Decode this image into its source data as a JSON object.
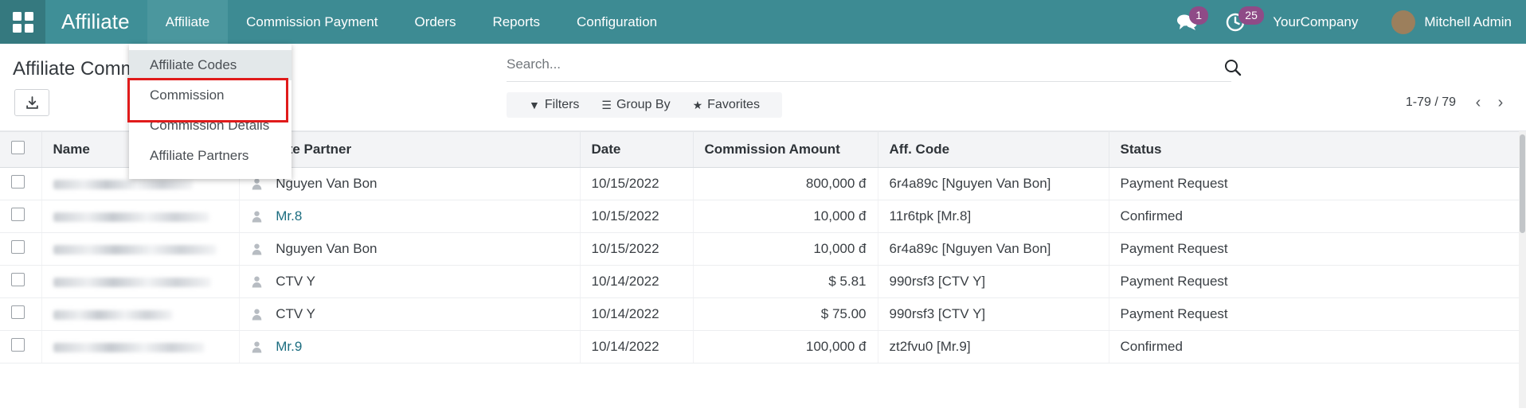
{
  "navbar": {
    "apps_icon": "apps-grid-icon",
    "brand": "Affiliate",
    "menu": [
      {
        "label": "Affiliate",
        "active": true
      },
      {
        "label": "Commission Payment",
        "active": false
      },
      {
        "label": "Orders",
        "active": false
      },
      {
        "label": "Reports",
        "active": false
      },
      {
        "label": "Configuration",
        "active": false
      }
    ],
    "messages_icon": "chat-bubbles-icon",
    "messages_badge": "1",
    "activities_icon": "clock-icon",
    "activities_badge": "25",
    "company": "YourCompany",
    "avatar_icon": "user-avatar",
    "user": "Mitchell Admin"
  },
  "dropdown": {
    "items": [
      {
        "label": "Affiliate Codes",
        "hovered": true
      },
      {
        "label": "Commission",
        "hovered": false
      },
      {
        "label": "Commission Details",
        "hovered": false
      },
      {
        "label": "Affiliate Partners",
        "hovered": false
      }
    ],
    "highlight_color": "#e01b1b"
  },
  "control_panel": {
    "breadcrumb": "Affiliate Comm",
    "export_button_icon": "download-icon",
    "search": {
      "placeholder": "Search...",
      "value": "",
      "search_icon": "search-icon"
    },
    "filter_bar": [
      {
        "label": "Filters",
        "icon": "funnel-icon"
      },
      {
        "label": "Group By",
        "icon": "hamburger-icon"
      },
      {
        "label": "Favorites",
        "icon": "star-icon"
      }
    ],
    "pager": {
      "count": "1-79 / 79",
      "prev_icon": "chevron-left-icon",
      "next_icon": "chevron-right-icon"
    }
  },
  "table": {
    "columns": [
      "",
      "Name",
      "Affiliate Partner",
      "Date",
      "Commission Amount",
      "Aff. Code",
      "Status"
    ],
    "rows": [
      {
        "name": "",
        "name_blurred": true,
        "partner": "Nguyen Van Bon",
        "date": "10/15/2022",
        "amount": "800,000 đ",
        "code": "6r4a89c [Nguyen Van Bon]",
        "status": "Payment Request",
        "link": false
      },
      {
        "name": "",
        "name_blurred": true,
        "partner": "Mr.8",
        "date": "10/15/2022",
        "amount": "10,000 đ",
        "code": "11r6tpk [Mr.8]",
        "status": "Confirmed",
        "link": true
      },
      {
        "name": "",
        "name_blurred": true,
        "partner": "Nguyen Van Bon",
        "date": "10/15/2022",
        "amount": "10,000 đ",
        "code": "6r4a89c [Nguyen Van Bon]",
        "status": "Payment Request",
        "link": false
      },
      {
        "name": "",
        "name_blurred": true,
        "partner": "CTV Y",
        "date": "10/14/2022",
        "amount": "$ 5.81",
        "code": "990rsf3 [CTV Y]",
        "status": "Payment Request",
        "link": false
      },
      {
        "name": "",
        "name_blurred": true,
        "partner": "CTV Y",
        "date": "10/14/2022",
        "amount": "$ 75.00",
        "code": "990rsf3 [CTV Y]",
        "status": "Payment Request",
        "link": false
      },
      {
        "name": "",
        "name_blurred": true,
        "partner": "Mr.9",
        "date": "10/14/2022",
        "amount": "100,000 đ",
        "code": "zt2fvu0 [Mr.9]",
        "status": "Confirmed",
        "link": true
      }
    ]
  },
  "theme": {
    "navbar_bg": "#3d8b93",
    "badge_bg": "#8f4b87",
    "link_color": "#1c6d80",
    "header_bg": "#f3f4f6"
  }
}
